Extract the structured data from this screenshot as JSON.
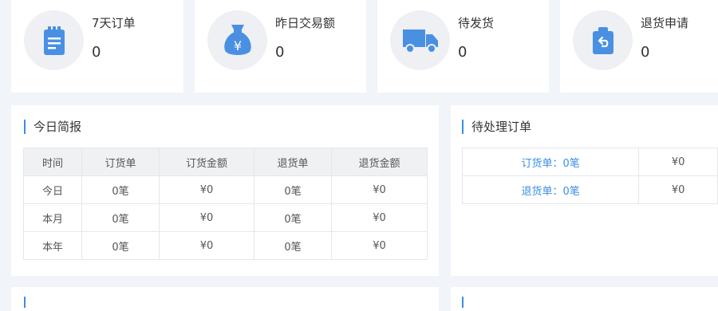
{
  "stats": [
    {
      "label": "7天订单",
      "value": "0",
      "icon": "clipboard-icon"
    },
    {
      "label": "昨日交易额",
      "value": "0",
      "icon": "money-bag-icon"
    },
    {
      "label": "待发货",
      "value": "0",
      "icon": "truck-icon"
    },
    {
      "label": "退货申请",
      "value": "0",
      "icon": "return-box-icon"
    }
  ],
  "brief": {
    "title": "今日简报",
    "headers": [
      "时间",
      "订货单",
      "订货金额",
      "退货单",
      "退货金额"
    ],
    "rows": [
      [
        "今日",
        "0笔",
        "¥0",
        "0笔",
        "¥0"
      ],
      [
        "本月",
        "0笔",
        "¥0",
        "0笔",
        "¥0"
      ],
      [
        "本年",
        "0笔",
        "¥0",
        "0笔",
        "¥0"
      ]
    ]
  },
  "pending": {
    "title": "待处理订单",
    "rows": [
      {
        "label": "订货单：0笔",
        "amount": "¥0"
      },
      {
        "label": "退货单：0笔",
        "amount": "¥0"
      }
    ]
  },
  "colors": {
    "accent": "#3a8ee6",
    "icon_blue": "#4a90e2"
  }
}
